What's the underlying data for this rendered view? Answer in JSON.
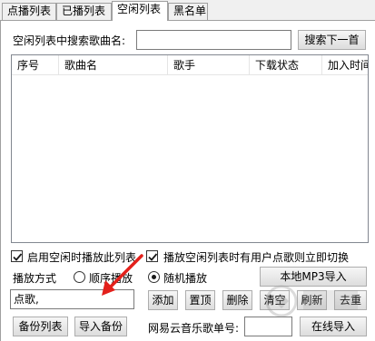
{
  "tabs": [
    {
      "label": "点播列表",
      "active": false
    },
    {
      "label": "已播列表",
      "active": false
    },
    {
      "label": "空闲列表",
      "active": true
    },
    {
      "label": "黑名单",
      "active": false
    }
  ],
  "search": {
    "label": "空闲列表中搜索歌曲名:",
    "value": "",
    "button": "搜索下一首"
  },
  "list": {
    "columns": [
      "序号",
      "歌曲名",
      "歌手",
      "下载状态",
      "加入时间"
    ],
    "rows": []
  },
  "options": {
    "enable_idle": {
      "label": "启用空闲时播放此列表",
      "checked": true
    },
    "switch_on_request": {
      "label": "播放空闲列表时有用户点歌则立即切换",
      "checked": true
    }
  },
  "play_mode": {
    "label": "播放方式",
    "sequential": {
      "label": "顺序播放",
      "selected": false
    },
    "random": {
      "label": "随机播放",
      "selected": true
    }
  },
  "local_button": "本地MP3导入",
  "song_input": {
    "value": "点歌,"
  },
  "actions": {
    "add": "添加",
    "top": "置顶",
    "delete": "删除",
    "clear": "清空",
    "refresh": "刷新",
    "dedupe": "去重"
  },
  "backup": {
    "backup_list": "备份列表",
    "import_backup": "导入备份"
  },
  "netease": {
    "label": "网易云音乐歌单号:",
    "value": "",
    "button": "在线导入"
  },
  "colors": {
    "arrow": "#e3201b",
    "check": "#1a1a1a"
  }
}
